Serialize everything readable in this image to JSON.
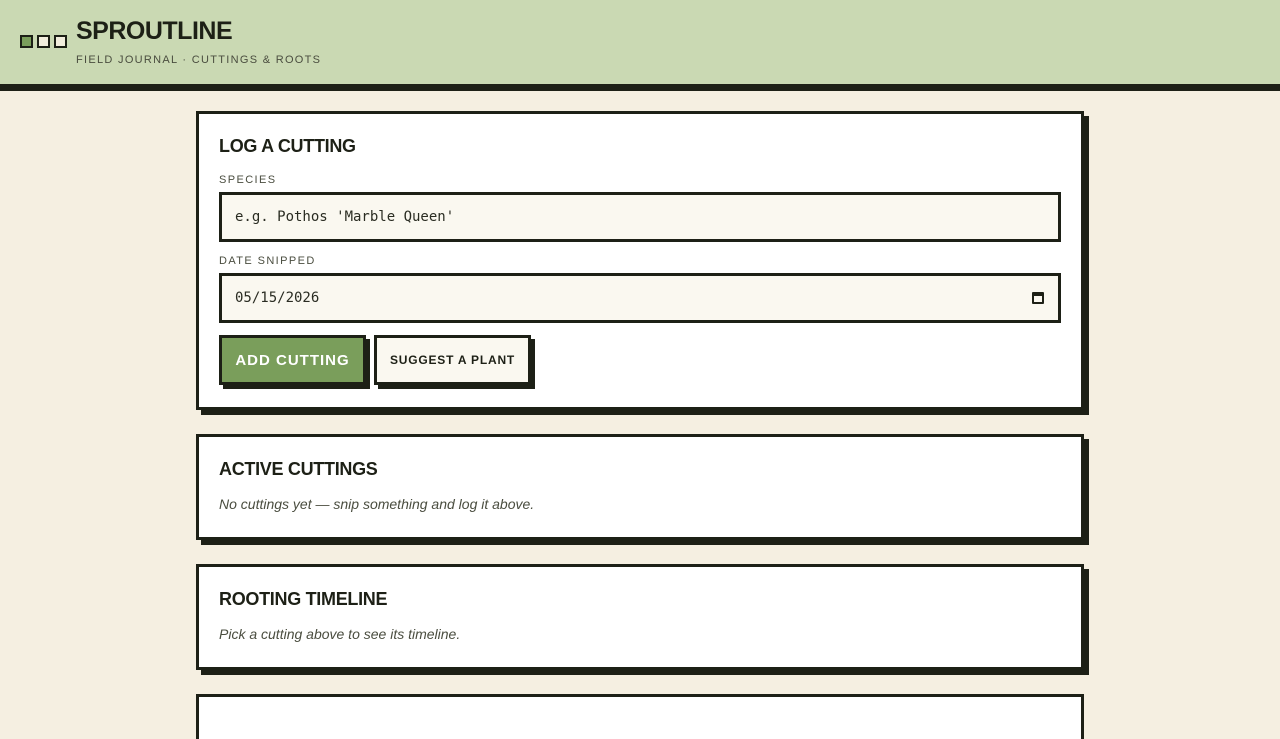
{
  "app": {
    "title": "SPROUTLINE",
    "subtitle": "FIELD JOURNAL · CUTTINGS & ROOTS"
  },
  "log_form": {
    "heading": "LOG A CUTTING",
    "species_label": "SPECIES",
    "species_placeholder": "e.g. Pothos 'Marble Queen'",
    "date_label": "DATE SNIPPED",
    "date_value": "05/15/2026",
    "add_button": "ADD CUTTING",
    "suggest_button": "SUGGEST A PLANT"
  },
  "active_cuttings": {
    "heading": "ACTIVE CUTTINGS",
    "empty_message": "No cuttings yet — snip something and log it above."
  },
  "rooting_timeline": {
    "heading": "ROOTING TIMELINE",
    "empty_message": "Pick a cutting above to see its timeline."
  },
  "colors": {
    "header_bg": "#cad9b3",
    "page_bg": "#f5efe1",
    "ink": "#1d2016",
    "accent_green": "#7a9e5b"
  }
}
